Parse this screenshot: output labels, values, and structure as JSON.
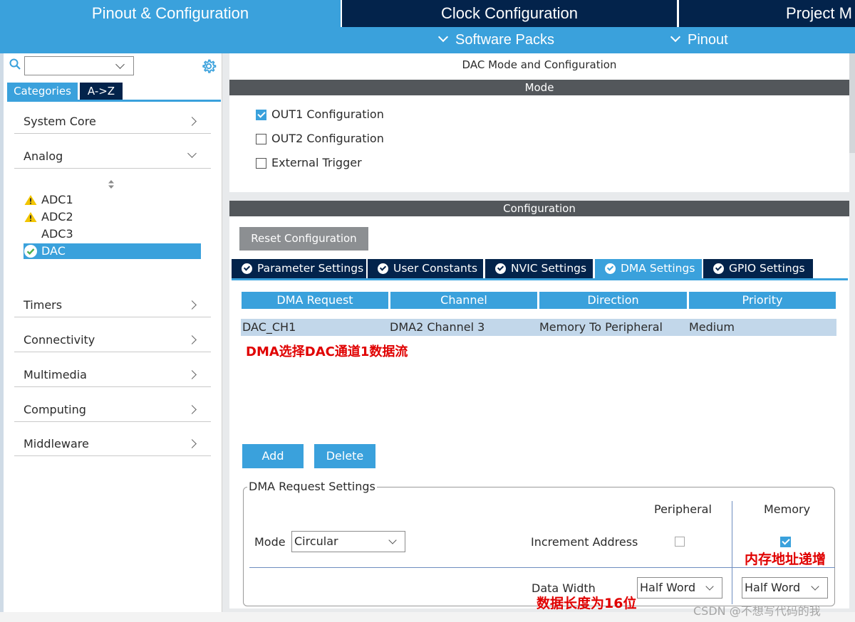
{
  "top_tabs": {
    "pinout": "Pinout & Configuration",
    "clock": "Clock Configuration",
    "project": "Project M"
  },
  "sub_bar": {
    "software_packs": "Software Packs",
    "pinout": "Pinout"
  },
  "left": {
    "search": {
      "value": ""
    },
    "tabs": {
      "categories": "Categories",
      "az": "A->Z"
    },
    "categories": [
      {
        "label": "System Core",
        "expanded": false
      },
      {
        "label": "Analog",
        "expanded": true
      },
      {
        "label": "Timers",
        "expanded": false
      },
      {
        "label": "Connectivity",
        "expanded": false
      },
      {
        "label": "Multimedia",
        "expanded": false
      },
      {
        "label": "Computing",
        "expanded": false
      },
      {
        "label": "Middleware",
        "expanded": false
      }
    ],
    "analog_items": [
      {
        "label": "ADC1",
        "status": "warning"
      },
      {
        "label": "ADC2",
        "status": "warning"
      },
      {
        "label": "ADC3",
        "status": "none"
      },
      {
        "label": "DAC",
        "status": "ok",
        "selected": true
      }
    ]
  },
  "mode": {
    "title": "DAC Mode and Configuration",
    "header": "Mode",
    "options": [
      {
        "label": "OUT1 Configuration",
        "checked": true
      },
      {
        "label": "OUT2 Configuration",
        "checked": false
      },
      {
        "label": "External Trigger",
        "checked": false
      }
    ]
  },
  "config": {
    "header": "Configuration",
    "reset_button": "Reset Configuration",
    "tabs": [
      {
        "label": "Parameter Settings",
        "active": false
      },
      {
        "label": "User Constants",
        "active": false
      },
      {
        "label": "NVIC Settings",
        "active": false
      },
      {
        "label": "DMA Settings",
        "active": true
      },
      {
        "label": "GPIO Settings",
        "active": false
      }
    ],
    "dma_table": {
      "columns": [
        "DMA Request",
        "Channel",
        "Direction",
        "Priority"
      ],
      "rows": [
        [
          "DAC_CH1",
          "DMA2 Channel 3",
          "Memory To Peripheral",
          "Medium"
        ]
      ]
    },
    "annotation_dma": "DMA选择DAC通道1数据流",
    "add_button": "Add",
    "delete_button": "Delete",
    "request_settings": {
      "title": "DMA Request Settings",
      "col_peripheral": "Peripheral",
      "col_memory": "Memory",
      "mode_label": "Mode",
      "mode_value": "Circular",
      "increment_label": "Increment Address",
      "increment_peripheral": false,
      "increment_memory": true,
      "annotation_memory": "内存地址递增",
      "data_width_label": "Data Width",
      "data_width_peripheral": "Half Word",
      "data_width_memory": "Half Word",
      "annotation_width": "数据长度为16位"
    }
  },
  "watermark": "CSDN @不想写代码的我",
  "colors": {
    "accent_blue": "#3aa1dc",
    "dark_navy": "#03234b",
    "header_gray": "#53575b",
    "annotation_red": "#e00000"
  }
}
